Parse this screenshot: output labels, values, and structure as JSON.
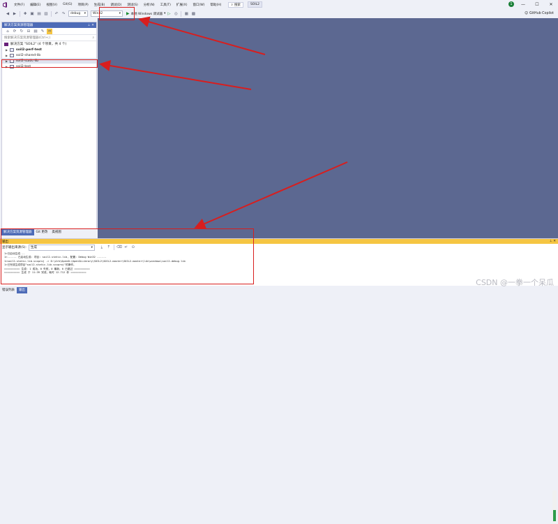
{
  "menu": {
    "items": [
      "文件(F)",
      "编辑(E)",
      "视图(V)",
      "Git(G)",
      "项目(P)",
      "生成(B)",
      "调试(D)",
      "测试(S)",
      "分析(N)",
      "工具(T)",
      "扩展(X)",
      "窗口(W)",
      "帮助(H)"
    ],
    "search_label": "搜索",
    "solution_name": "SOIL2"
  },
  "toolbar": {
    "config": "debug",
    "platform": "Win32",
    "run_label": "本地 Windows 调试器",
    "copilot_label": "GitHub Copilot",
    "badge_count": "1"
  },
  "solution_explorer": {
    "title": "解决方案资源管理器",
    "search_placeholder": "搜索解决方案资源管理器(Ctrl+;)",
    "solution_label": "解决方案 \"SOIL2\" (4 个项目，共 4 个)",
    "projects": [
      "soil2-perf-test",
      "soil2-shared-lib",
      "soil2-static-lib",
      "soil2-test"
    ],
    "tabs": [
      "解决方案资源管理器",
      "Git 更改",
      "类视图"
    ]
  },
  "output": {
    "title": "输出",
    "source_label": "显示输出来源(S):",
    "source_value": "生成",
    "lines": [
      "1>已启动生成...",
      "1>------ 已启动生成: 项目: soil2-static-lib, 配置: Debug Win32 ------",
      "1>soil2-static-lib.vcxproj -> D:\\Ark\\OpenGL\\OpenGLLibrary\\SOIL2\\SOIL2-master\\SOIL2-master\\lib\\windows\\soil2-debug.lib",
      "1>已完成生成项目\"soil2-static-lib.vcxproj\"的操作。",
      "========== 生成: 1 成功，0 失败，0 最新，0 已跳过 ==========",
      "========== 生成 于 11:39 完成，耗时 12.712 秒 =========="
    ]
  },
  "status_tabs": [
    "错误列表",
    "输出"
  ],
  "watermark": "CSDN @一拳一个呆瓜",
  "colors": {
    "accent": "#4d6bb7",
    "editor_bg": "#5c6891",
    "highlight": "#d81e1e",
    "output_title": "#f5c542"
  }
}
